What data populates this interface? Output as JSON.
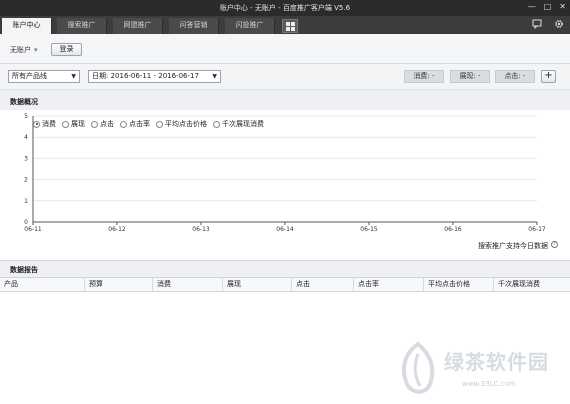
{
  "window": {
    "title": "账户中心 - 无账户 - 百度推广客户端 V5.6",
    "controls": [
      "—",
      "□",
      "✕"
    ]
  },
  "tabs": [
    {
      "label": "账户中心",
      "active": true
    },
    {
      "label": "搜索推广",
      "active": false
    },
    {
      "label": "网盟推广",
      "active": false
    },
    {
      "label": "问答营销",
      "active": false
    },
    {
      "label": "闪投推广",
      "active": false
    }
  ],
  "toolbar": {
    "account_label": "无账户",
    "account_caret": "▾",
    "login_label": "登录"
  },
  "filters": {
    "product_line": "所有产品线",
    "date_range": "日期: 2016-06-11 - 2016-06-17",
    "metrics": [
      {
        "label": "消费: -"
      },
      {
        "label": "展现: -"
      },
      {
        "label": "点击: -"
      }
    ],
    "add_label": "+"
  },
  "overview": {
    "title": "数据概况",
    "radios": [
      {
        "label": "消费",
        "checked": true
      },
      {
        "label": "展现",
        "checked": false
      },
      {
        "label": "点击",
        "checked": false
      },
      {
        "label": "点击率",
        "checked": false
      },
      {
        "label": "平均点击价格",
        "checked": false
      },
      {
        "label": "千次展现消费",
        "checked": false
      }
    ],
    "footnote": "搜索推广支持今日数据",
    "help": "?"
  },
  "chart_data": {
    "type": "line",
    "x": [
      "06-11",
      "06-12",
      "06-13",
      "06-14",
      "06-15",
      "06-16",
      "06-17"
    ],
    "y_ticks": [
      0,
      1,
      2,
      3,
      4,
      5
    ],
    "ylim": [
      0,
      5
    ],
    "series": [],
    "grid": true,
    "xlabel": "",
    "ylabel": ""
  },
  "report": {
    "title": "数据报告",
    "columns": [
      "产品",
      "预算",
      "消费",
      "展现",
      "点击",
      "点击率",
      "平均点击价格",
      "千次展现消费"
    ],
    "rows": []
  },
  "watermark": {
    "text": "绿茶软件园",
    "url": "www.33LC.com"
  },
  "colors": {
    "titlebar": "#2b2b2b",
    "tabbar": "#3c3c3c",
    "accent": "#4a7fc1"
  }
}
